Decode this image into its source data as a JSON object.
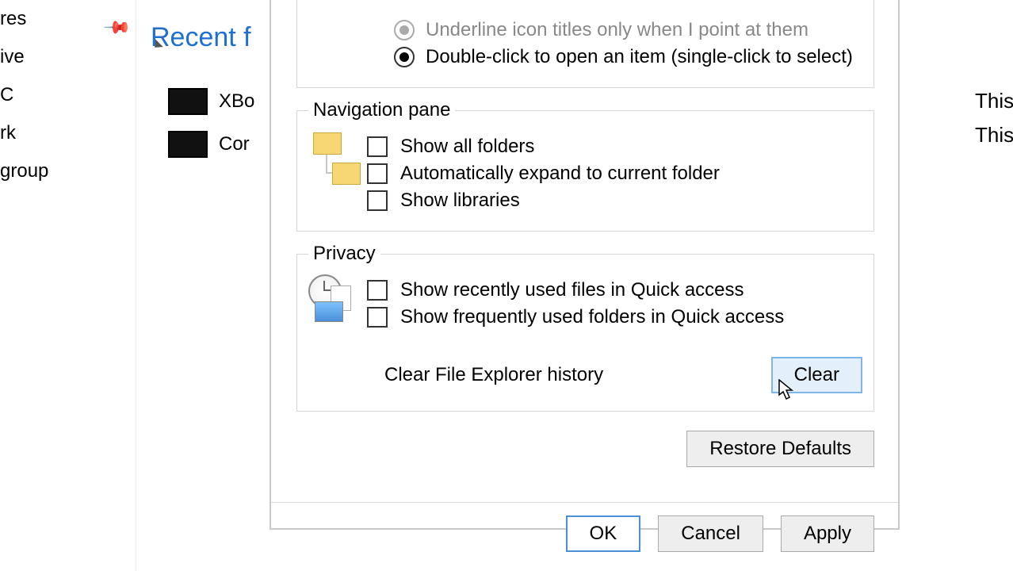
{
  "left_pane": {
    "items": [
      "res",
      "ive",
      "C",
      "rk",
      "group"
    ]
  },
  "mid_pane": {
    "recent_header": "Recent f",
    "items": [
      "XBo",
      "Cor"
    ]
  },
  "click_items": {
    "underline": "Underline icon titles only when I point at them",
    "double_click": "Double-click to open an item (single-click to select)"
  },
  "nav_pane": {
    "legend": "Navigation pane",
    "show_all": "Show all folders",
    "auto_expand": "Automatically expand to current folder",
    "show_libs": "Show libraries"
  },
  "privacy": {
    "legend": "Privacy",
    "recent_files": "Show recently used files in Quick access",
    "frequent_folders": "Show frequently used folders in Quick access",
    "clear_label": "Clear File Explorer history",
    "clear_btn": "Clear"
  },
  "restore_btn": "Restore Defaults",
  "footer": {
    "ok": "OK",
    "cancel": "Cancel",
    "apply": "Apply"
  },
  "right_clip": {
    "l1": "This",
    "l2": "This"
  }
}
